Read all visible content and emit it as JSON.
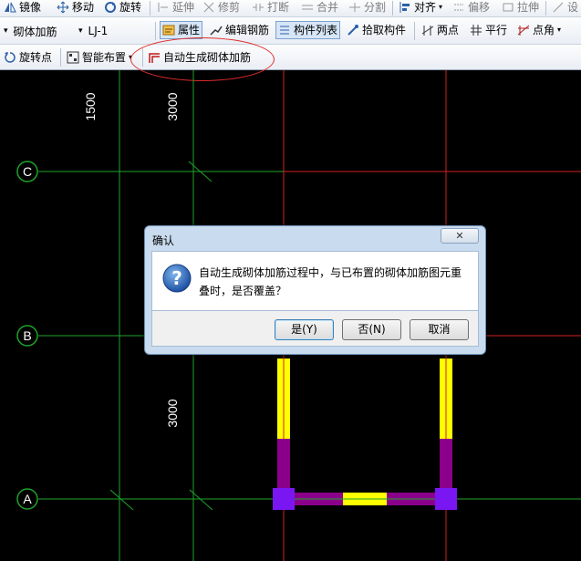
{
  "toolbar1": {
    "items": [
      {
        "label": "镜像",
        "icon": "mirror-icon",
        "enabled": true
      },
      {
        "label": "移动",
        "icon": "move-icon",
        "enabled": true
      },
      {
        "label": "旋转",
        "icon": "rotate-icon",
        "enabled": true
      },
      {
        "label": "延伸",
        "icon": "extend-icon",
        "enabled": false
      },
      {
        "label": "修剪",
        "icon": "trim-icon",
        "enabled": false
      },
      {
        "label": "打断",
        "icon": "break-icon",
        "enabled": false
      },
      {
        "label": "合并",
        "icon": "merge-icon",
        "enabled": false
      },
      {
        "label": "分割",
        "icon": "split-icon",
        "enabled": false
      },
      {
        "label": "对齐",
        "icon": "align-icon",
        "enabled": true
      },
      {
        "label": "偏移",
        "icon": "offset-icon",
        "enabled": false
      },
      {
        "label": "拉伸",
        "icon": "stretch-icon",
        "enabled": false
      },
      {
        "label": "设",
        "icon": "set-icon",
        "enabled": false
      }
    ]
  },
  "toolbar2": {
    "component_type": "砌体加筋",
    "component_name": "LJ-1",
    "properties": "属性",
    "edit_rebar": "编辑钢筋",
    "component_list": "构件列表",
    "pick_component": "拾取构件",
    "two_points": "两点",
    "parallel": "平行",
    "point_angle": "点角"
  },
  "toolbar3": {
    "rotate_point": "旋转点",
    "smart_layout": "智能布置",
    "auto_generate": "自动生成砌体加筋"
  },
  "canvas": {
    "axis_labels": [
      "C",
      "B",
      "A"
    ],
    "dimensions": [
      "1500",
      "3000",
      "3000"
    ],
    "colors": {
      "background": "#000000",
      "axis_green": "#1fa32a",
      "axis_red": "#d42020",
      "wall_yellow": "#ffff00",
      "wall_purple": "#8b008b",
      "column_blue": "#7a16f2"
    }
  },
  "dialog": {
    "title": "确认",
    "close_symbol": "✕",
    "icon": "question-icon",
    "message_line1": "自动生成砌体加筋过程中，与已布置的砌体加筋图元重",
    "message_line2": "叠时，是否覆盖？",
    "yes": "是(Y)",
    "no": "否(N)",
    "cancel": "取消"
  }
}
